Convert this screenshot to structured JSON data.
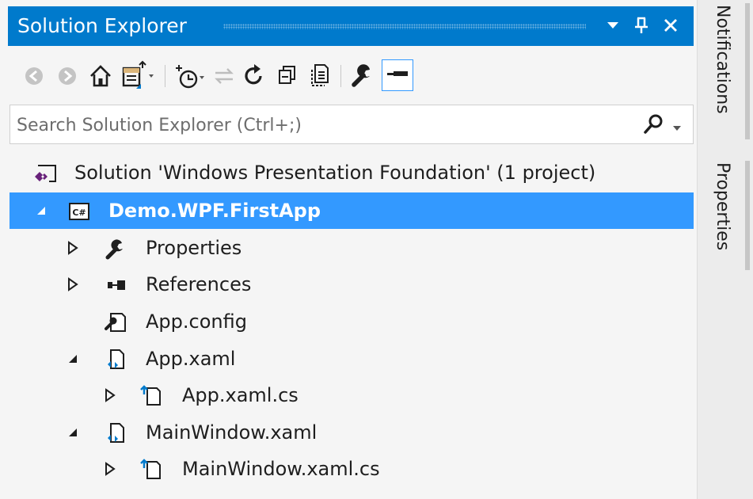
{
  "window": {
    "title": "Solution Explorer",
    "accent_color": "#007acc",
    "title_buttons": [
      {
        "icon": "dropdown-arrow-icon"
      },
      {
        "icon": "pin-icon"
      },
      {
        "icon": "close-icon"
      }
    ]
  },
  "toolbar": {
    "buttons": [
      {
        "icon": "back-icon"
      },
      {
        "icon": "forward-icon"
      },
      {
        "icon": "home-icon"
      },
      {
        "icon": "switch-views-icon"
      },
      {
        "icon": "pending-changes-filter-icon"
      },
      {
        "icon": "sync-with-active-document-icon"
      },
      {
        "icon": "refresh-icon"
      },
      {
        "icon": "collapse-all-icon"
      },
      {
        "icon": "show-all-files-icon"
      },
      {
        "icon": "properties-wrench-icon"
      },
      {
        "icon": "preview-selected-items-icon"
      }
    ]
  },
  "search": {
    "placeholder": "Search Solution Explorer (Ctrl+;)",
    "value": ""
  },
  "tree": {
    "selection_color": "#3399ff",
    "items": [
      {
        "label": "Solution 'Windows Presentation Foundation' (1 project)",
        "icon": "solution-icon",
        "expander": "none"
      },
      {
        "label": "Demo.WPF.FirstApp",
        "icon": "csharp-project-icon",
        "expander": "expanded",
        "selected": true
      },
      {
        "label": "Properties",
        "icon": "wrench-icon",
        "expander": "collapsed"
      },
      {
        "label": "References",
        "icon": "references-icon",
        "expander": "collapsed"
      },
      {
        "label": "App.config",
        "icon": "config-file-icon",
        "expander": "none"
      },
      {
        "label": "App.xaml",
        "icon": "xaml-file-icon",
        "expander": "expanded"
      },
      {
        "label": "App.xaml.cs",
        "icon": "csharp-file-icon",
        "expander": "collapsed"
      },
      {
        "label": "MainWindow.xaml",
        "icon": "xaml-file-icon",
        "expander": "expanded"
      },
      {
        "label": "MainWindow.xaml.cs",
        "icon": "csharp-file-icon",
        "expander": "collapsed"
      }
    ]
  },
  "side_tabs": [
    {
      "label": "Notifications"
    },
    {
      "label": "Properties"
    }
  ]
}
